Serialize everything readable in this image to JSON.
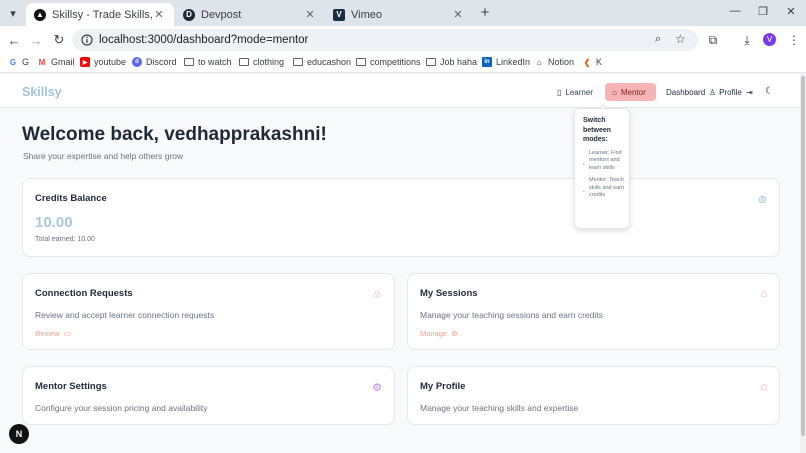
{
  "browser": {
    "tabs": [
      {
        "title": "Skillsy - Trade Skills, Earn Credits",
        "active": true
      },
      {
        "title": "Devpost",
        "active": false
      },
      {
        "title": "Vimeo",
        "active": false
      }
    ],
    "url": "localhost:3000/dashboard?mode=mentor",
    "profile_initial": "V",
    "bookmarks": [
      "G",
      "Gmail",
      "youtube",
      "Discord",
      "to watch",
      "clothing",
      "educashon",
      "competitions",
      "Job haha",
      "LinkedIn",
      "Notion",
      "K"
    ]
  },
  "app": {
    "logo": "Skillsy",
    "nav": {
      "learner_label": "Learner",
      "mentor_label": "Mentor",
      "dashboard_label": "Dashboard",
      "profile_label": "Profile"
    },
    "tooltip": {
      "title": "Switch between modes:",
      "learner": "Learner: Find mentors and learn skills",
      "mentor": "Mentor: Teach skills and earn credits"
    },
    "welcome": "Welcome back, vedhapprakashni!",
    "subtitle": "Share your expertise and help others grow",
    "credits": {
      "title": "Credits Balance",
      "value": "10.00",
      "total": "Total earned: 10.00"
    },
    "cards": {
      "connection": {
        "title": "Connection Requests",
        "desc": "Review and accept learner connection requests",
        "link": "Review"
      },
      "sessions": {
        "title": "My Sessions",
        "desc": "Manage your teaching sessions and earn credits",
        "link": "Manage"
      },
      "settings": {
        "title": "Mentor Settings",
        "desc": "Configure your session pricing and availability"
      },
      "profile": {
        "title": "My Profile",
        "desc": "Manage your teaching skills and expertise"
      }
    },
    "badge": "N"
  },
  "colors": {
    "mentor_active": "#f6b4b4",
    "accent_orange": "#f4a08a",
    "accent_purple": "#c084fc",
    "credits_blue": "#a8c8de"
  }
}
